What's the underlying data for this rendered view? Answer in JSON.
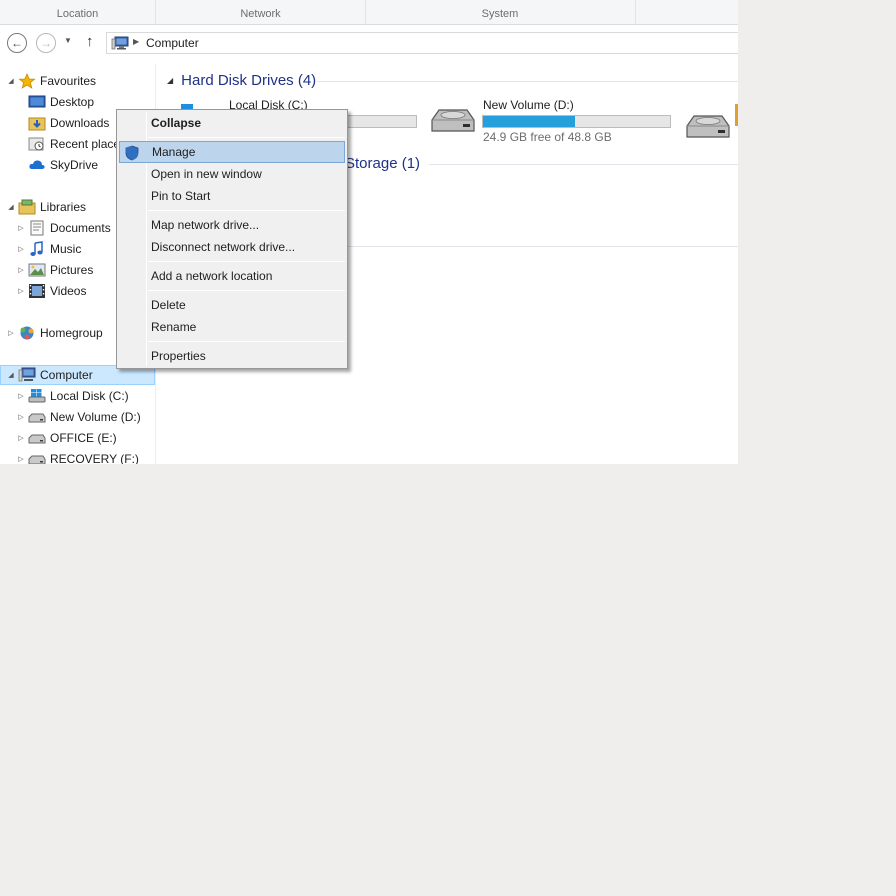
{
  "ribbon": {
    "groups": [
      "Location",
      "Network",
      "System"
    ]
  },
  "address": {
    "crumb": "Computer"
  },
  "navpane": {
    "favourites": "Favourites",
    "desktop": "Desktop",
    "downloads": "Downloads",
    "recent": "Recent places",
    "skydrive": "SkyDrive",
    "libraries": "Libraries",
    "documents": "Documents",
    "music": "Music",
    "pictures": "Pictures",
    "videos": "Videos",
    "homegroup": "Homegroup",
    "computer": "Computer",
    "local_c": "Local Disk (C:)",
    "new_volume_d": "New Volume (D:)",
    "office_e": "OFFICE (E:)",
    "recovery_f": "RECOVERY (F:)"
  },
  "content": {
    "hdd_group": "Hard Disk Drives (4)",
    "removable_group": "Storage (1)",
    "drives": [
      {
        "name": "Local Disk (C:)",
        "free": "",
        "fill_pct": 0
      },
      {
        "name": "New Volume (D:)",
        "free": "24.9 GB free of 48.8 GB",
        "fill_pct": 49
      }
    ]
  },
  "context_menu": {
    "items": [
      "Collapse",
      "Manage",
      "Open in new window",
      "Pin to Start",
      "Map network drive...",
      "Disconnect network drive...",
      "Add a network location",
      "Delete",
      "Rename",
      "Properties"
    ]
  },
  "colors": {
    "accent": "#26a0da",
    "group_heading": "#1e3287",
    "menu_hover": "#bdd5ec",
    "selection": "#cce8ff"
  }
}
